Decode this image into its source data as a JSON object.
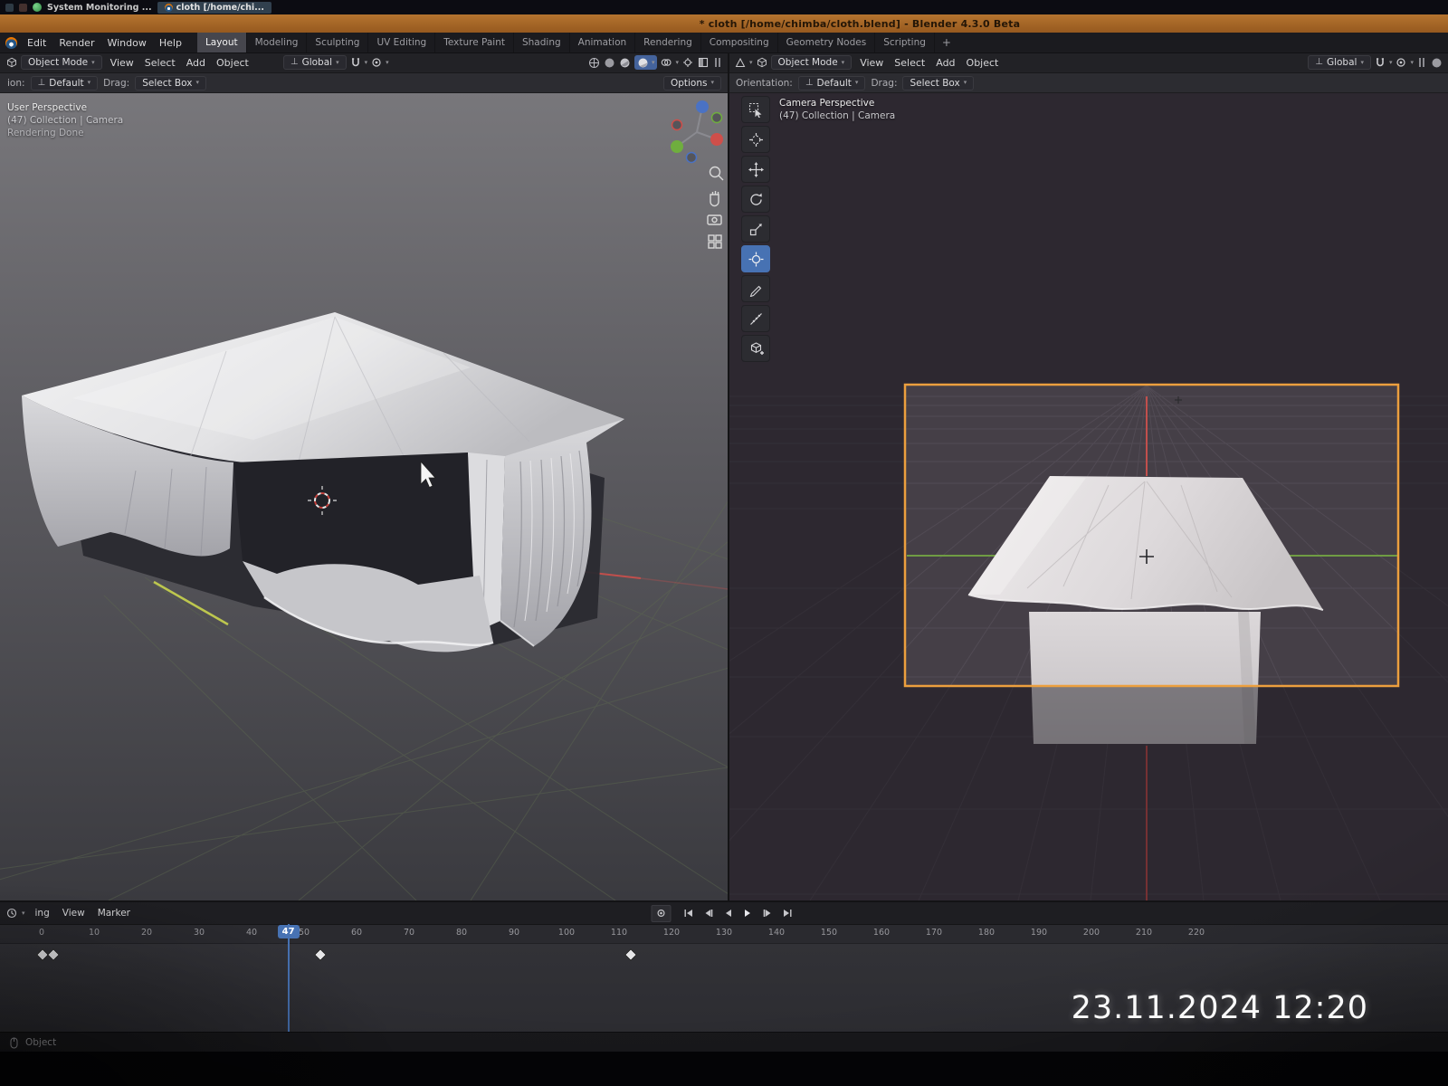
{
  "taskbar": {
    "app1": "System Monitoring ...",
    "app2": "cloth [/home/chi..."
  },
  "titlebar": {
    "title": "* cloth [/home/chimba/cloth.blend] - Blender 4.3.0 Beta"
  },
  "menubar": {
    "menus": [
      "Edit",
      "Render",
      "Window",
      "Help"
    ],
    "workspaces": [
      {
        "label": "Layout",
        "active": true
      },
      {
        "label": "Modeling"
      },
      {
        "label": "Sculpting"
      },
      {
        "label": "UV Editing"
      },
      {
        "label": "Texture Paint"
      },
      {
        "label": "Shading"
      },
      {
        "label": "Animation"
      },
      {
        "label": "Rendering"
      },
      {
        "label": "Compositing"
      },
      {
        "label": "Geometry Nodes"
      },
      {
        "label": "Scripting"
      }
    ],
    "add_tab": "+"
  },
  "viewport_left": {
    "mode": "Object Mode",
    "menus": [
      "View",
      "Select",
      "Add",
      "Object"
    ],
    "orientation": "Global",
    "tool_settings": {
      "orientation_label": "ion:",
      "orientation_value": "Default",
      "drag_label": "Drag:",
      "drag_value": "Select Box",
      "options": "Options"
    },
    "overlay": {
      "line1": "User Perspective",
      "line2": "(47) Collection | Camera",
      "line3": "Rendering Done"
    }
  },
  "viewport_right": {
    "mode": "Object Mode",
    "menus": [
      "View",
      "Select",
      "Add",
      "Object"
    ],
    "orientation": "Global",
    "tool_settings": {
      "orientation_label": "Orientation:",
      "orientation_value": "Default",
      "drag_label": "Drag:",
      "drag_value": "Select Box"
    },
    "overlay": {
      "line1": "Camera Perspective",
      "line2": "(47) Collection | Camera"
    },
    "tools": [
      "select-box",
      "cursor",
      "move",
      "rotate",
      "scale",
      "transform",
      "annotate",
      "measure",
      "add-cube"
    ],
    "active_tool": "transform"
  },
  "timeline": {
    "menus": [
      "ing",
      "View",
      "Marker"
    ],
    "frame_labels": [
      "0",
      "10",
      "20",
      "30",
      "40",
      "50",
      "60",
      "70",
      "80",
      "90",
      "100",
      "110",
      "120",
      "130",
      "140",
      "150",
      "160",
      "170",
      "180",
      "190",
      "200",
      "210",
      "220"
    ],
    "current_frame": "47",
    "keyframes": [
      0,
      2,
      53,
      112
    ]
  },
  "statusbar": {
    "mode_label": "Object"
  },
  "photo_timestamp": "23.11.2024 12:20",
  "colors": {
    "accent_blue": "#4772b3",
    "camera_border": "#ec9f3e",
    "titlebar_orange": "#a8662a",
    "axis_red": "#c14f4c",
    "axis_green": "#6f9c43",
    "axis_yellow": "#c9d44e"
  }
}
